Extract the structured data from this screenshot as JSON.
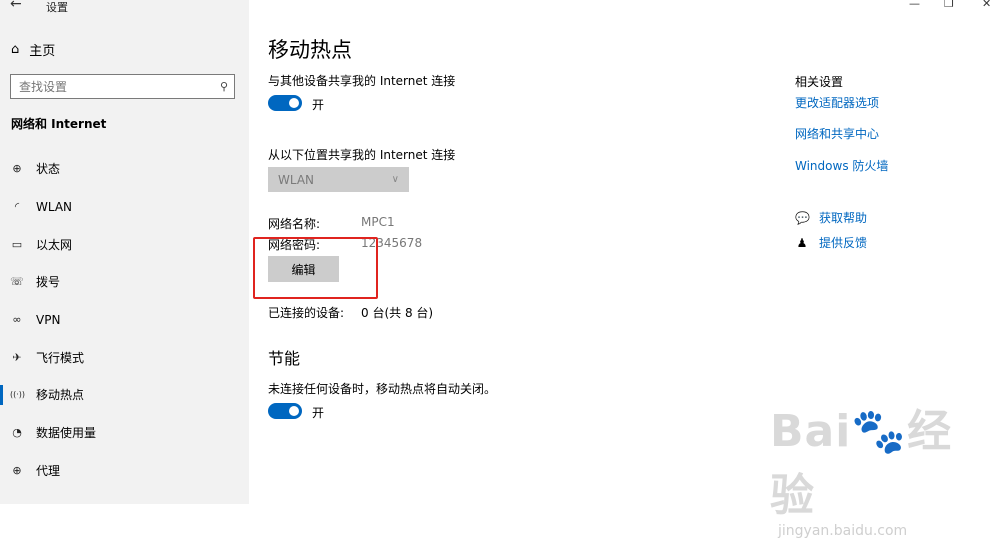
{
  "window": {
    "title": "设置",
    "back_icon": "←",
    "minimize": "—",
    "restore": "❐",
    "close": "✕"
  },
  "sidebar": {
    "home_label": "主页",
    "search_placeholder": "查找设置",
    "section_title": "网络和 Internet",
    "items": [
      {
        "label": "状态",
        "icon": "globe-icon",
        "glyph": "⊕"
      },
      {
        "label": "WLAN",
        "icon": "wifi-icon",
        "glyph": "◜"
      },
      {
        "label": "以太网",
        "icon": "ethernet-icon",
        "glyph": "▭"
      },
      {
        "label": "拨号",
        "icon": "dialup-icon",
        "glyph": "☏"
      },
      {
        "label": "VPN",
        "icon": "vpn-icon",
        "glyph": "∞"
      },
      {
        "label": "飞行模式",
        "icon": "airplane-icon",
        "glyph": "✈"
      },
      {
        "label": "移动热点",
        "icon": "hotspot-icon",
        "glyph": "((·))",
        "active": true
      },
      {
        "label": "数据使用量",
        "icon": "data-usage-icon",
        "glyph": "◔"
      },
      {
        "label": "代理",
        "icon": "proxy-icon",
        "glyph": "⊕"
      }
    ]
  },
  "main": {
    "title": "移动热点",
    "share_label": "与其他设备共享我的 Internet 连接",
    "share_toggle_text": "开",
    "share_from_label": "从以下位置共享我的 Internet 连接",
    "share_from_value": "WLAN",
    "network_name_label": "网络名称:",
    "network_name_value": "MPC1",
    "network_password_label": "网络密码:",
    "network_password_value": "12345678",
    "edit_button": "编辑",
    "connected_label": "已连接的设备:",
    "connected_value": "0 台(共 8 台)",
    "power_title": "节能",
    "power_desc": "未连接任何设备时，移动热点将自动关闭。",
    "power_toggle_text": "开"
  },
  "related": {
    "title": "相关设置",
    "links": [
      "更改适配器选项",
      "网络和共享中心",
      "Windows 防火墙"
    ],
    "help_label": "获取帮助",
    "feedback_label": "提供反馈"
  },
  "watermark": {
    "logo": "Bai🐾经验",
    "url": "jingyan.baidu.com"
  },
  "colors": {
    "accent": "#0067c0",
    "highlight": "#e0241f",
    "sidebar_bg": "#f2f2f2"
  }
}
